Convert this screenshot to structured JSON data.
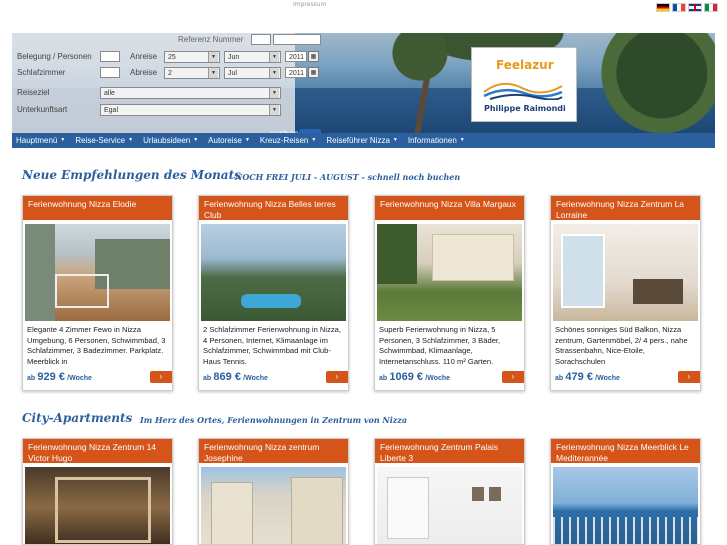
{
  "top": {
    "impressum": "Impressum",
    "languages": [
      "de",
      "fr",
      "en",
      "it"
    ]
  },
  "search": {
    "referenz_label": "Referenz Nummer",
    "belegung_label": "Belegung / Personen",
    "schlafzimmer_label": "Schlafzimmer",
    "anreise_label": "Anreise",
    "abreise_label": "Abreise",
    "anreise_day": "25",
    "anreise_month": "Jun",
    "anreise_year": "2011",
    "abreise_day": "2",
    "abreise_month": "Jul",
    "abreise_year": "2011",
    "reiseziel_label": "Reiseziel",
    "reiseziel_value": "alle",
    "unterkunft_label": "Unterkunftsart",
    "unterkunft_value": "Egal",
    "search_text": "suchen"
  },
  "logo": {
    "brand": "Feelazur",
    "name": "Philippe Raimondi",
    "colors": {
      "brand": "#e89a1c",
      "name": "#1d3f78"
    }
  },
  "nav": {
    "items": [
      "Hauptmenü",
      "Reise-Service",
      "Urlaubsideen",
      "Autoreise",
      "Kreuz-Reisen",
      "Reiseführer Nizza",
      "Informationen"
    ]
  },
  "section1": {
    "title": "Neue Empfehlungen des Monats",
    "subtitle": "NOCH FREI JULI - AUGUST - schnell noch buchen"
  },
  "section2": {
    "title": "City-Apartments",
    "subtitle": "Im Herz des Ortes, Ferienwohnungen in Zentrum von Nizza"
  },
  "cards1": [
    {
      "title": "Ferienwohnung Nizza Elodie",
      "desc": "Elegante 4 Zimmer Fewo in Nizza Umgebung, 6 Personen, Schwimmbad, 3 Schlafzimmer, 3 Badezimmer. Parkplatz. Meerblick in",
      "ab": "ab",
      "price": "929 €",
      "per": "/Woche"
    },
    {
      "title": "Ferienwohnung Nizza Belles terres Club",
      "desc": "2 Schlafzimmer Ferienwohnung in Nizza, 4 Personen, Internet, Klimaanlage im Schlafzimmer, Schwimmbad mit Club-Haus Tennis.",
      "ab": "ab",
      "price": "869 €",
      "per": "/Woche"
    },
    {
      "title": "Ferienwohnung Nizza Villa Margaux",
      "desc": "Superb Ferienwohnung in Nizza, 5 Personen, 3 Schlafzimmer, 3 Bäder, Schwimmbad, Klimaanlage, Internetanschluss. 110 m² Garten.",
      "ab": "ab",
      "price": "1069 €",
      "per": "/Woche"
    },
    {
      "title": "Ferienwohnung Nizza Zentrum La Lorraine",
      "desc": "Schönes sonniges Süd Balkon, Nizza zentrum, Gartenmöbel, 2/ 4 pers., nahe Strassenbahn, Nice-Etoile, Sorachschulen",
      "ab": "ab",
      "price": "479 €",
      "per": "/Woche"
    }
  ],
  "cards2": [
    {
      "title": "Ferienwohnung Nizza Zentrum 14 Victor Hugo"
    },
    {
      "title": "Ferienwohnung Nizza zentrum Josephine"
    },
    {
      "title": "Ferienwohnung Zentrum Palais Liberte 3"
    },
    {
      "title": "Ferienwohnung Nizza Meerblick Le Mediterannée"
    }
  ],
  "colors": {
    "accent": "#d4541a",
    "nav": "#2b5f9e",
    "title": "#2b5f9e"
  }
}
